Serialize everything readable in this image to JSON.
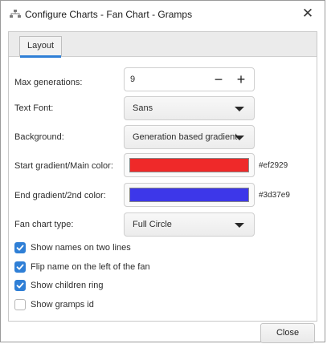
{
  "window": {
    "title": "Configure Charts - Fan Chart - Gramps",
    "close_icon": "close-icon"
  },
  "tabs": [
    {
      "label": "Layout"
    }
  ],
  "form": {
    "max_generations": {
      "label": "Max generations:",
      "value": "9",
      "minus": "−",
      "plus": "+"
    },
    "text_font": {
      "label": "Text Font:",
      "value": "Sans"
    },
    "background": {
      "label": "Background:",
      "value": "Generation based gradient"
    },
    "start_color": {
      "label": "Start gradient/Main color:",
      "hex": "#ef2929",
      "color": "#ef2929"
    },
    "end_color": {
      "label": "End gradient/2nd color:",
      "hex": "#3d37e9",
      "color": "#3d37e9"
    },
    "fan_chart_type": {
      "label": "Fan chart type:",
      "value": "Full Circle"
    }
  },
  "checkboxes": [
    {
      "label": "Show names on two lines",
      "checked": true
    },
    {
      "label": "Flip name on the left of the fan",
      "checked": true
    },
    {
      "label": "Show children ring",
      "checked": true
    },
    {
      "label": "Show gramps id",
      "checked": false
    }
  ],
  "footer": {
    "close_label": "Close"
  },
  "colors": {
    "accent": "#2f7fd6"
  }
}
